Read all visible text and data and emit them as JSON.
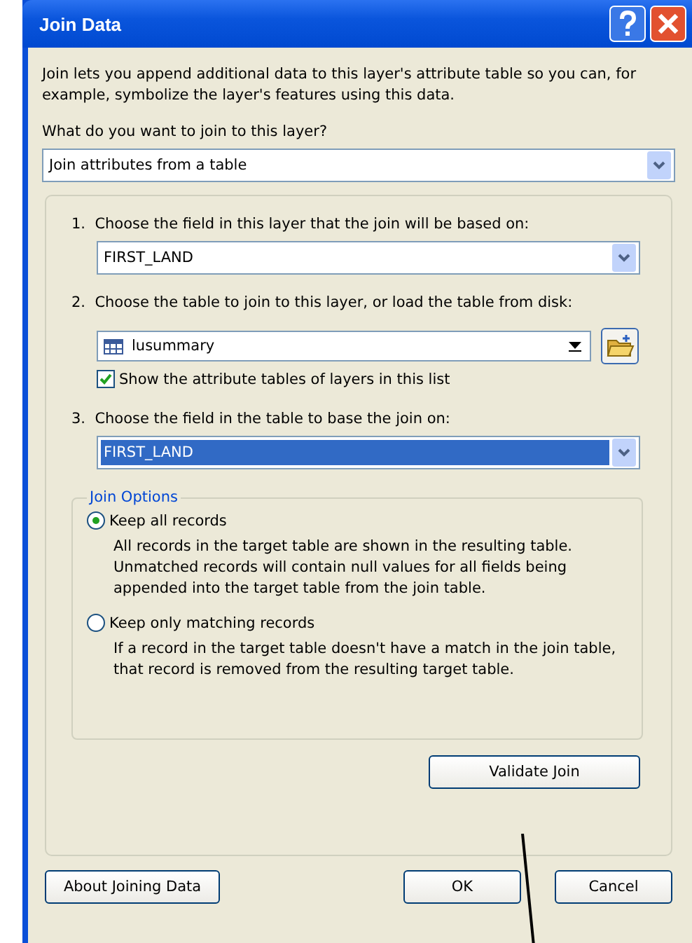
{
  "window": {
    "title": "Join Data"
  },
  "intro": "Join lets you append additional data to this layer's attribute table so you can, for example, symbolize the layer's features using this data.",
  "join_type": {
    "label": "What do you want to join to this layer?",
    "value": "Join attributes from a table"
  },
  "steps": [
    {
      "kind": "dropdown",
      "number": "1.",
      "label": "Choose the field in this layer that the join will be based on:",
      "value": "FIRST_LAND",
      "highlighted": false
    },
    {
      "kind": "table-picker",
      "number": "2.",
      "label": "Choose the table to join to this layer, or load the table from disk:",
      "value": "lusummary",
      "checkbox": {
        "label": "Show the attribute tables of layers in this list",
        "checked": true
      }
    },
    {
      "kind": "dropdown",
      "number": "3.",
      "label": "Choose the field in the table to base the join on:",
      "value": "FIRST_LAND",
      "highlighted": true
    }
  ],
  "join_options": {
    "legend": "Join Options",
    "options": [
      {
        "label": "Keep all records",
        "description": "All records in the target table are shown in the resulting table. Unmatched records will contain null values for all fields being appended into the target table from the join table.",
        "selected": true
      },
      {
        "label": "Keep only matching records",
        "description": "If a record in the target table doesn't have a match in the join table, that record is removed from the resulting target table.",
        "selected": false
      }
    ]
  },
  "validate_button": "Validate Join",
  "buttons": [
    "About Joining Data",
    "OK",
    "Cancel"
  ]
}
